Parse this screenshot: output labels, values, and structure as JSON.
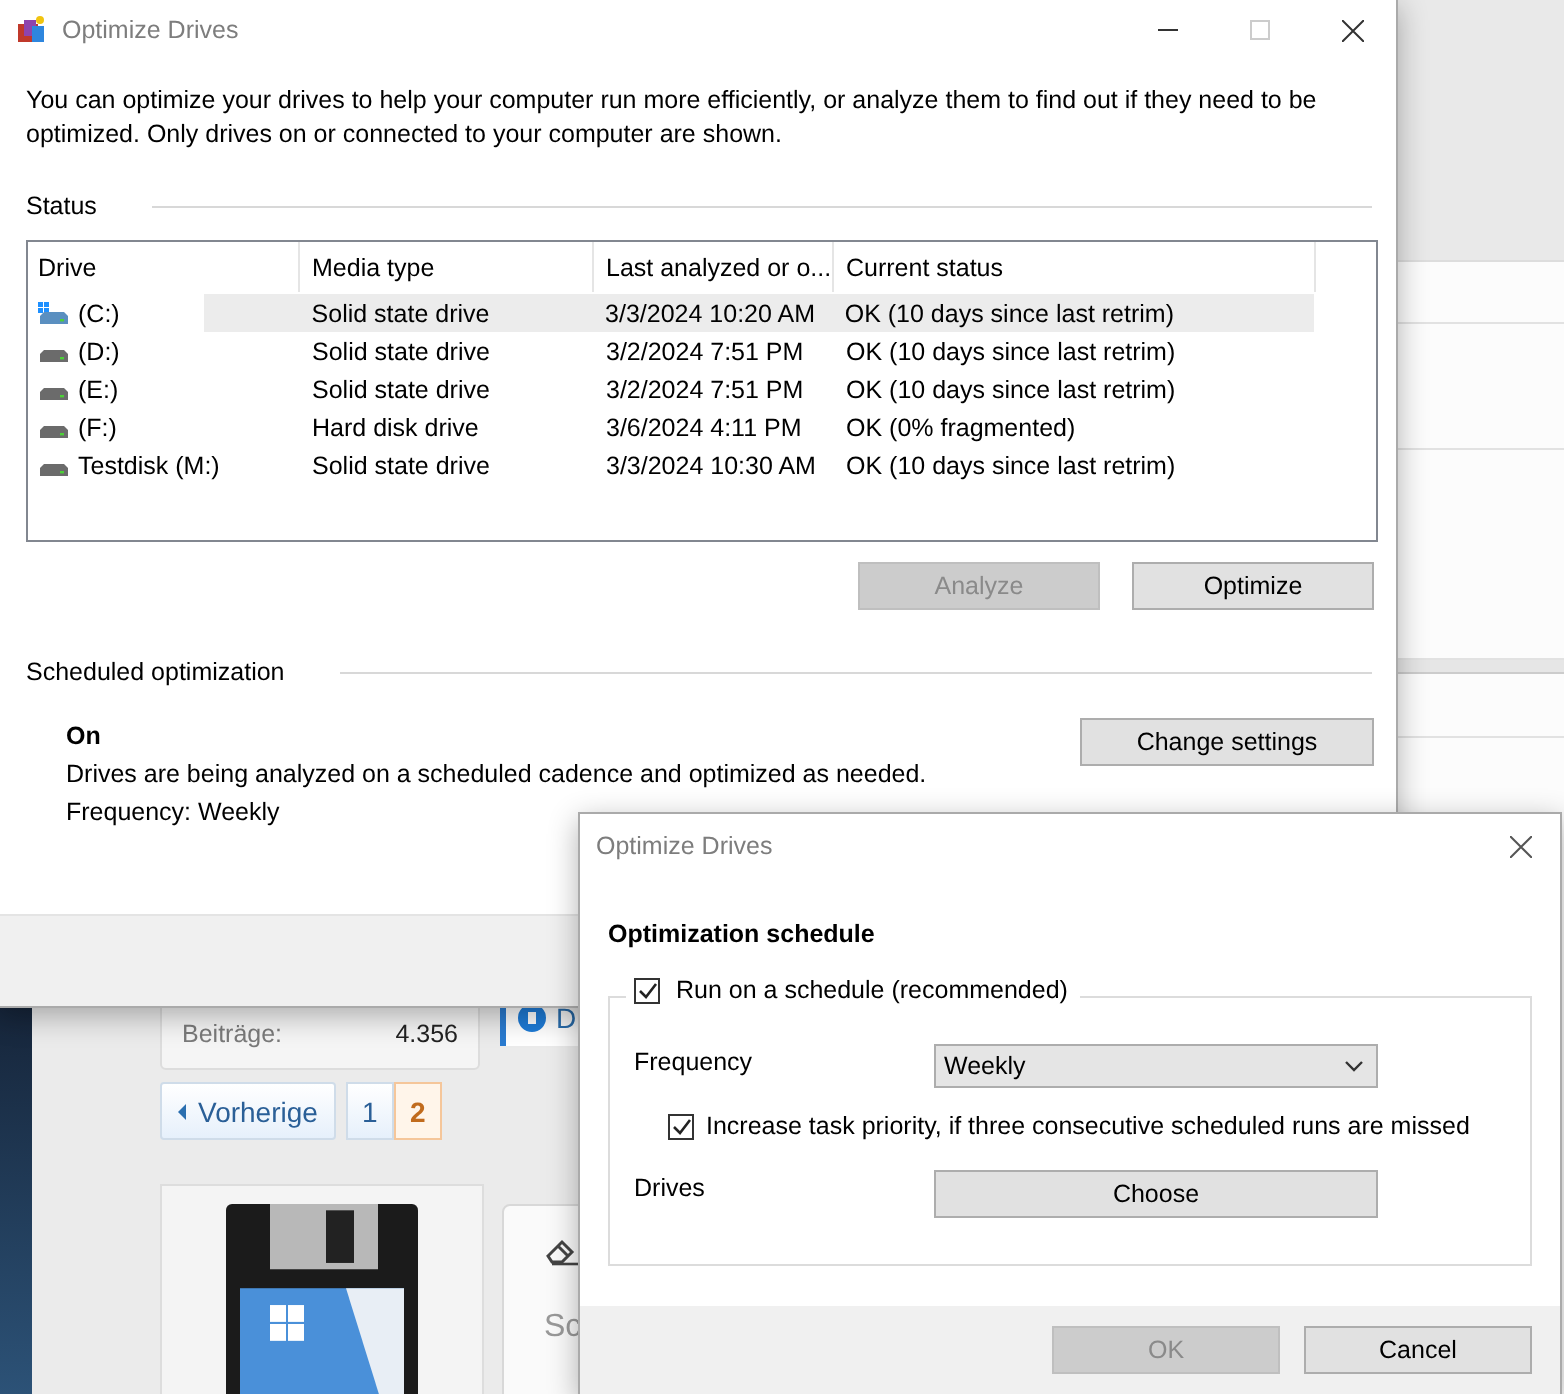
{
  "background_page": {
    "stats": [
      {
        "label": "Beiträge:",
        "value": "4.356"
      }
    ],
    "partial_button": "D",
    "pagination": {
      "previous": "Vorherige",
      "pages": [
        {
          "label": "1",
          "selected": false
        },
        {
          "label": "2",
          "selected": true
        }
      ]
    },
    "post": {
      "partial_text": "Sc"
    }
  },
  "main_window": {
    "title": "Optimize Drives",
    "intro": "You can optimize your drives to help your computer run more efficiently, or analyze them to find out if they need to be optimized. Only drives on or connected to your computer are shown.",
    "status_heading": "Status",
    "table": {
      "columns": [
        "Drive",
        "Media type",
        "Last analyzed or o...",
        "Current status"
      ],
      "rows": [
        {
          "drive": "(C:)",
          "system": true,
          "media_type": "Solid state drive",
          "last_analyzed": "3/3/2024 10:20 AM",
          "status": "OK (10 days since last retrim)",
          "selected": true
        },
        {
          "drive": "(D:)",
          "system": false,
          "media_type": "Solid state drive",
          "last_analyzed": "3/2/2024 7:51 PM",
          "status": "OK (10 days since last retrim)",
          "selected": false
        },
        {
          "drive": "(E:)",
          "system": false,
          "media_type": "Solid state drive",
          "last_analyzed": "3/2/2024 7:51 PM",
          "status": "OK (10 days since last retrim)",
          "selected": false
        },
        {
          "drive": "(F:)",
          "system": false,
          "media_type": "Hard disk drive",
          "last_analyzed": "3/6/2024 4:11 PM",
          "status": "OK (0% fragmented)",
          "selected": false
        },
        {
          "drive": "Testdisk (M:)",
          "system": false,
          "media_type": "Solid state drive",
          "last_analyzed": "3/3/2024 10:30 AM",
          "status": "OK (10 days since last retrim)",
          "selected": false
        }
      ]
    },
    "buttons": [
      {
        "label": "Analyze",
        "disabled": true
      },
      {
        "label": "Optimize",
        "disabled": false
      }
    ],
    "scheduled": {
      "heading": "Scheduled optimization",
      "state": "On",
      "description": "Drives are being analyzed on a scheduled cadence and optimized as needed.",
      "frequency": "Frequency: Weekly",
      "button": "Change settings"
    }
  },
  "dialog": {
    "title": "Optimize Drives",
    "heading": "Optimization schedule",
    "run_on_schedule": {
      "label": "Run on a schedule (recommended)",
      "checked": true
    },
    "frequency": {
      "label": "Frequency",
      "value": "Weekly"
    },
    "increase_priority": {
      "label": "Increase task priority, if three consecutive scheduled runs are missed",
      "checked": true
    },
    "drives": {
      "label": "Drives",
      "button": "Choose"
    },
    "buttons": [
      {
        "label": "OK",
        "disabled": true
      },
      {
        "label": "Cancel",
        "disabled": false
      }
    ]
  }
}
